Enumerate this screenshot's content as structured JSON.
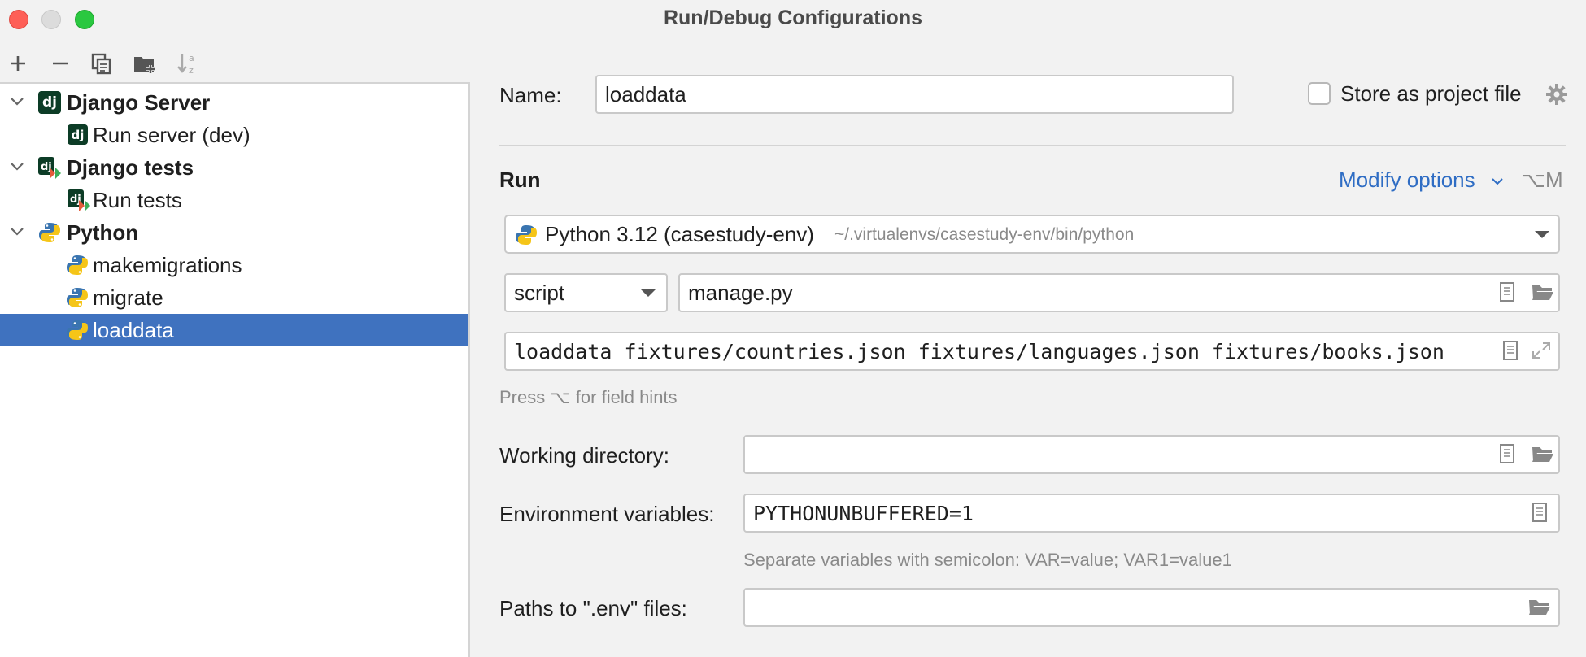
{
  "window": {
    "title": "Run/Debug Configurations"
  },
  "toolbar": {
    "buttons": [
      "add-icon",
      "remove-icon",
      "copy-icon",
      "new-folder-icon",
      "sort-alphabetically-icon"
    ]
  },
  "tree": [
    {
      "label": "Django Server",
      "type": "group",
      "icon": "django-icon",
      "expanded": true
    },
    {
      "label": "Run server (dev)",
      "type": "item",
      "icon": "django-icon"
    },
    {
      "label": "Django tests",
      "type": "group",
      "icon": "django-tests-icon",
      "expanded": true
    },
    {
      "label": "Run tests",
      "type": "item",
      "icon": "django-tests-icon"
    },
    {
      "label": "Python",
      "type": "group",
      "icon": "python-icon",
      "expanded": true
    },
    {
      "label": "makemigrations",
      "type": "item",
      "icon": "python-icon"
    },
    {
      "label": "migrate",
      "type": "item",
      "icon": "python-icon"
    },
    {
      "label": "loaddata",
      "type": "item",
      "icon": "python-icon",
      "selected": true
    }
  ],
  "form": {
    "name_label": "Name:",
    "name_value": "loaddata",
    "store_label": "Store as project file",
    "run_heading": "Run",
    "modify_options": "Modify options",
    "modify_shortcut": "⌥M",
    "interpreter_name": "Python 3.12 (casestudy-env)",
    "interpreter_path": "~/.virtualenvs/casestudy-env/bin/python",
    "script_type": "script",
    "script_value": "manage.py",
    "parameters_value": "loaddata fixtures/countries.json fixtures/languages.json fixtures/books.json",
    "field_hint": "Press ⌥ for field hints",
    "workdir_label": "Working directory:",
    "workdir_value": "",
    "env_label": "Environment variables:",
    "env_value": "PYTHONUNBUFFERED=1",
    "env_hint": "Separate variables with semicolon: VAR=value; VAR1=value1",
    "dotenv_label": "Paths to \".env\" files:",
    "dotenv_value": ""
  },
  "colors": {
    "selection": "#3f72bf",
    "link": "#2f6dc4",
    "django": "#0c3c26"
  }
}
